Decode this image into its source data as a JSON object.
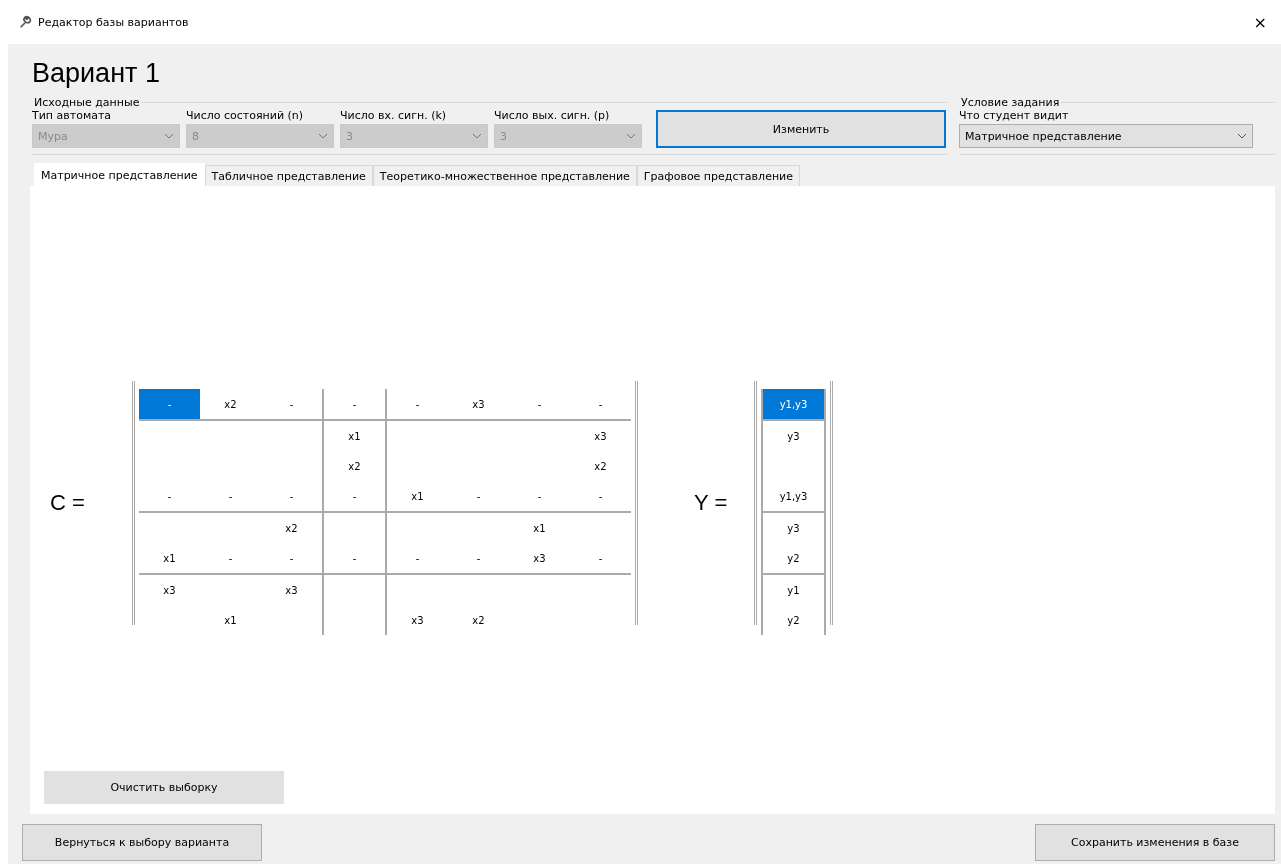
{
  "window": {
    "title": "Редактор базы вариантов",
    "close": "×"
  },
  "heading": "Вариант 1",
  "source_group": {
    "title": "Исходные данные",
    "fields": [
      {
        "label": "Тип автомата",
        "value": "Мура",
        "disabled": true
      },
      {
        "label": "Число состояний (n)",
        "value": "8",
        "disabled": true
      },
      {
        "label": "Число вх. сигн. (k)",
        "value": "3",
        "disabled": true
      },
      {
        "label": "Число вых. сигн. (p)",
        "value": "3",
        "disabled": true
      }
    ],
    "button": "Изменить"
  },
  "task_group": {
    "title": "Условие задания",
    "label": "Что студент видит",
    "value": "Матричное представление"
  },
  "tabs": [
    {
      "label": "Матричное представление",
      "selected": true
    },
    {
      "label": "Табличное представление",
      "selected": false
    },
    {
      "label": "Теоретико-множественное представление",
      "selected": false
    },
    {
      "label": "Графовое представление",
      "selected": false
    }
  ],
  "matrix_c": {
    "label": "C =",
    "groups": [
      [
        [
          {
            "text": "-",
            "selected": true
          },
          {
            "text": "x2",
            "selected": false
          },
          {
            "text": "-",
            "selected": false
          },
          {
            "text": "-",
            "selected": false
          },
          {
            "text": "-",
            "selected": false
          },
          {
            "text": "x3",
            "selected": false
          },
          {
            "text": "-",
            "selected": false
          },
          {
            "text": "-",
            "selected": false
          }
        ]
      ],
      [
        [
          {
            "selected": false
          },
          {
            "selected": false
          },
          {
            "selected": false
          },
          {
            "text": "x1",
            "selected": false
          },
          {
            "selected": false
          },
          {
            "selected": false
          },
          {
            "selected": false
          },
          {
            "text": "x3",
            "selected": false
          }
        ],
        [
          {
            "selected": false
          },
          {
            "selected": false
          },
          {
            "selected": false
          },
          {
            "text": "x2",
            "selected": false
          },
          {
            "selected": false
          },
          {
            "selected": false
          },
          {
            "selected": false
          },
          {
            "text": "x2",
            "selected": false
          }
        ],
        [
          {
            "text": "-",
            "selected": false
          },
          {
            "text": "-",
            "selected": false
          },
          {
            "text": "-",
            "selected": false
          },
          {
            "text": "-",
            "selected": false
          },
          {
            "text": "x1",
            "selected": false
          },
          {
            "text": "-",
            "selected": false
          },
          {
            "text": "-",
            "selected": false
          },
          {
            "text": "-",
            "selected": false
          }
        ]
      ],
      [
        [
          {
            "selected": false
          },
          {
            "selected": false
          },
          {
            "text": "x2",
            "selected": false
          },
          {
            "selected": false
          },
          {
            "selected": false
          },
          {
            "selected": false
          },
          {
            "text": "x1",
            "selected": false
          },
          {
            "selected": false
          }
        ],
        [
          {
            "text": "x1",
            "selected": false
          },
          {
            "text": "-",
            "selected": false
          },
          {
            "text": "-",
            "selected": false
          },
          {
            "text": "-",
            "selected": false
          },
          {
            "text": "-",
            "selected": false
          },
          {
            "text": "-",
            "selected": false
          },
          {
            "text": "x3",
            "selected": false
          },
          {
            "text": "-",
            "selected": false
          }
        ]
      ],
      [
        [
          {
            "text": "x3",
            "selected": false
          },
          {
            "selected": false
          },
          {
            "text": "x3",
            "selected": false
          },
          {
            "selected": false
          },
          {
            "selected": false
          },
          {
            "selected": false
          },
          {
            "selected": false
          },
          {
            "selected": false
          }
        ],
        [
          {
            "selected": false
          },
          {
            "text": "x1",
            "selected": false
          },
          {
            "selected": false
          },
          {
            "selected": false
          },
          {
            "text": "x3",
            "selected": false
          },
          {
            "text": "x2",
            "selected": false
          },
          {
            "selected": false
          },
          {
            "selected": false
          }
        ]
      ]
    ]
  },
  "matrix_y": {
    "label": "Y =",
    "groups": [
      [
        {
          "text": "y1,y3",
          "selected": true
        }
      ],
      [
        {
          "text": "y3",
          "selected": false
        },
        {
          "selected": false
        },
        {
          "text": "y1,y3",
          "selected": false
        }
      ],
      [
        {
          "text": "y3",
          "selected": false
        },
        {
          "text": "y2",
          "selected": false
        }
      ],
      [
        {
          "text": "y1",
          "selected": false
        },
        {
          "text": "y2",
          "selected": false
        }
      ]
    ]
  },
  "clear_button": "Очистить выборку",
  "footer": {
    "back_button": "Вернуться к выбору варианта",
    "save_button": "Сохранить изменения в базе"
  }
}
